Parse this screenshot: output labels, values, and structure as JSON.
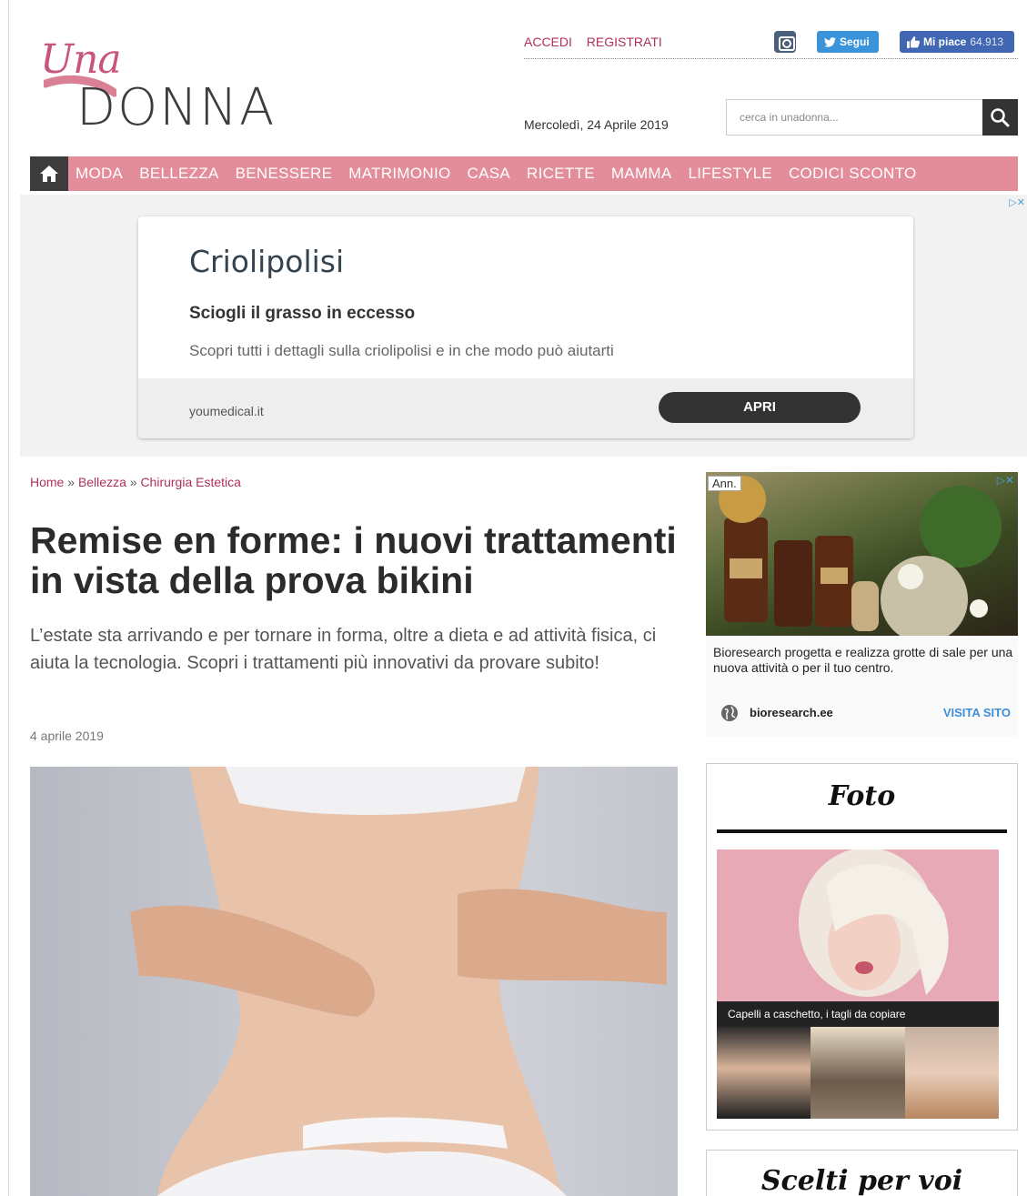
{
  "logo": {
    "una": "Una",
    "donna": "DONNA"
  },
  "account": {
    "login": "ACCEDI",
    "register": "REGISTRATI"
  },
  "social": {
    "twitter_label": "Segui",
    "facebook_label": "Mi piace",
    "facebook_count": "64.913",
    "instagram_icon": "instagram-icon"
  },
  "header": {
    "date": "Mercoledì, 24 Aprile 2019"
  },
  "search": {
    "placeholder": "cerca in unadonna..."
  },
  "nav": {
    "items": [
      "MODA",
      "BELLEZZA",
      "BENESSERE",
      "MATRIMONIO",
      "CASA",
      "RICETTE",
      "MAMMA",
      "LIFESTYLE",
      "CODICI SCONTO"
    ],
    "bg_color": "#e38d9b"
  },
  "top_ad": {
    "title": "Criolipolisi",
    "subtitle": "Sciogli il grasso in eccesso",
    "description": "Scopri tutti i dettagli sulla criolipolisi e in che modo può aiutarti",
    "domain": "youmedical.it",
    "cta": "APRI"
  },
  "breadcrumb": {
    "home": "Home",
    "sep": "»",
    "cat": "Bellezza",
    "sub": "Chirurgia Estetica"
  },
  "article": {
    "title": "Remise en forme: i nuovi trattamenti in vista della prova bikini",
    "lead": "L’estate sta arrivando e per tornare in forma, oltre a dieta e ad attività fisica, ci aiuta la tecnologia. Scopri i trattamenti più innovativi da provare subito!",
    "date": "4 aprile 2019"
  },
  "side_ad": {
    "badge": "Ann.",
    "text": "Bioresearch progetta e realizza grotte di sale per una nuova attività o per il tuo centro.",
    "domain": "bioresearch.ee",
    "cta": "VISITA SITO"
  },
  "foto": {
    "title": "Foto",
    "caption": "Capelli a caschetto, i tagli da copiare"
  },
  "scelti": {
    "title": "Scelti per voi"
  }
}
